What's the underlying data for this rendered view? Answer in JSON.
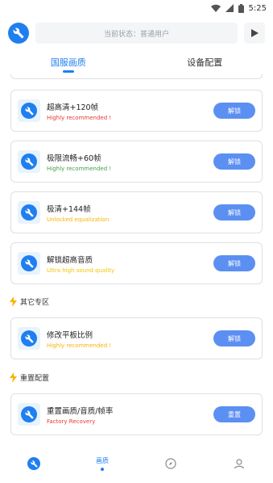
{
  "status_bar": {
    "time": "5:25"
  },
  "topbar": {
    "status_text": "当前状态：普通用户"
  },
  "tabs": [
    {
      "label": "国服画质",
      "active": true
    },
    {
      "label": "设备配置",
      "active": false
    }
  ],
  "cards": [
    {
      "title": "超高清+120帧",
      "subtitle": "Highly recommended !",
      "subtitle_color": "#e53935",
      "button": "解锁"
    },
    {
      "title": "极限流畅+60帧",
      "subtitle": "Highly recommended !",
      "subtitle_color": "#43a047",
      "button": "解锁"
    },
    {
      "title": "极清+144帧",
      "subtitle": "Unlocked equalization",
      "subtitle_color": "#f5b400",
      "button": "解锁"
    },
    {
      "title": "解锁超高音质",
      "subtitle": "Ultra high sound quality",
      "subtitle_color": "#f5c400",
      "button": "解锁"
    },
    {
      "title": "修改平板比例",
      "subtitle": "Highly recommended !",
      "subtitle_color": "#f5b400",
      "button": "解锁"
    },
    {
      "title": "重置画质/音质/帧率",
      "subtitle": "Factory Recovery",
      "subtitle_color": "#e53935",
      "button": "重置"
    }
  ],
  "sections": [
    {
      "label": "其它专区"
    },
    {
      "label": "重置配置"
    }
  ],
  "bottom_nav": [
    {
      "label": "",
      "icon": "wrench-icon"
    },
    {
      "label": "画质",
      "icon": ""
    },
    {
      "label": "",
      "icon": "compass-icon"
    },
    {
      "label": "",
      "icon": "user-icon"
    }
  ],
  "colors": {
    "accent": "#1f7ff0",
    "button": "#5c8ff2",
    "lightning": "#f5b400"
  }
}
